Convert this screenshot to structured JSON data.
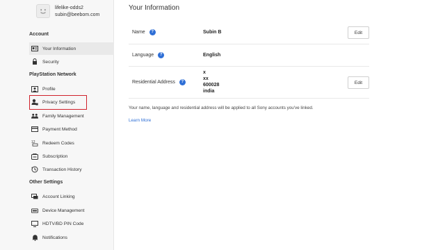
{
  "user": {
    "name": "lifelike-odds2",
    "email": "subin@beebom.com"
  },
  "sidebar": {
    "sections": [
      {
        "title": "Account",
        "items": [
          {
            "label": "Your Information",
            "icon": "id-card-icon"
          },
          {
            "label": "Security",
            "icon": "lock-icon"
          }
        ]
      },
      {
        "title": "PlayStation Network",
        "items": [
          {
            "label": "Profile",
            "icon": "profile-icon"
          },
          {
            "label": "Privacy Settings",
            "icon": "privacy-icon"
          },
          {
            "label": "Family Management",
            "icon": "family-icon"
          },
          {
            "label": "Payment Method",
            "icon": "credit-card-icon"
          },
          {
            "label": "Redeem Codes",
            "icon": "redeem-icon"
          },
          {
            "label": "Subscription",
            "icon": "subscription-icon"
          },
          {
            "label": "Transaction History",
            "icon": "history-icon"
          }
        ]
      },
      {
        "title": "Other Settings",
        "items": [
          {
            "label": "Account Linking",
            "icon": "link-icon"
          },
          {
            "label": "Device Management",
            "icon": "device-icon"
          },
          {
            "label": "HDTV/BD PIN Code",
            "icon": "tv-icon"
          },
          {
            "label": "Notifications",
            "icon": "bell-icon"
          }
        ]
      }
    ]
  },
  "main": {
    "title": "Your Information",
    "rows": [
      {
        "label": "Name",
        "value": "Subin B",
        "edit": "Edit"
      },
      {
        "label": "Language",
        "value": "English"
      },
      {
        "label": "Residential Address",
        "address": [
          "x",
          "xx",
          "600028",
          "india"
        ],
        "edit": "Edit"
      }
    ],
    "note": "Your name, language and residential address will be applied to all Sony accounts you've linked.",
    "learn_more": "Learn More"
  },
  "colors": {
    "highlight": "#d0202a",
    "link": "#2f6fd6"
  }
}
